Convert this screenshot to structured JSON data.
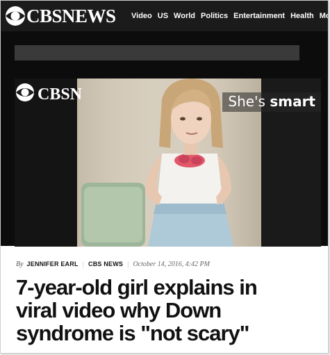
{
  "site": {
    "logo_text": "CBSNEWS",
    "logo_icon": "cbs-eye-icon"
  },
  "nav": {
    "items": [
      "Video",
      "US",
      "World",
      "Politics",
      "Entertainment",
      "Health",
      "MoneyW"
    ]
  },
  "video": {
    "caption_prefix": "She's ",
    "caption_strong": "smart",
    "watermark_icon": "cbs-eye-watermark-icon",
    "watermark_text": "CBSN"
  },
  "article": {
    "by_prefix": "By",
    "author": "JENNIFER EARL",
    "source": "CBS NEWS",
    "date": "October 14, 2016, 4:42 PM",
    "headline_lines": [
      "7-year-old girl explains in",
      "viral video why Down",
      "syndrome is \"not scary\""
    ]
  },
  "colors": {
    "nav_bg": "#1b1b1b",
    "video_bg": "#0c0c0c",
    "headline": "#111111"
  }
}
